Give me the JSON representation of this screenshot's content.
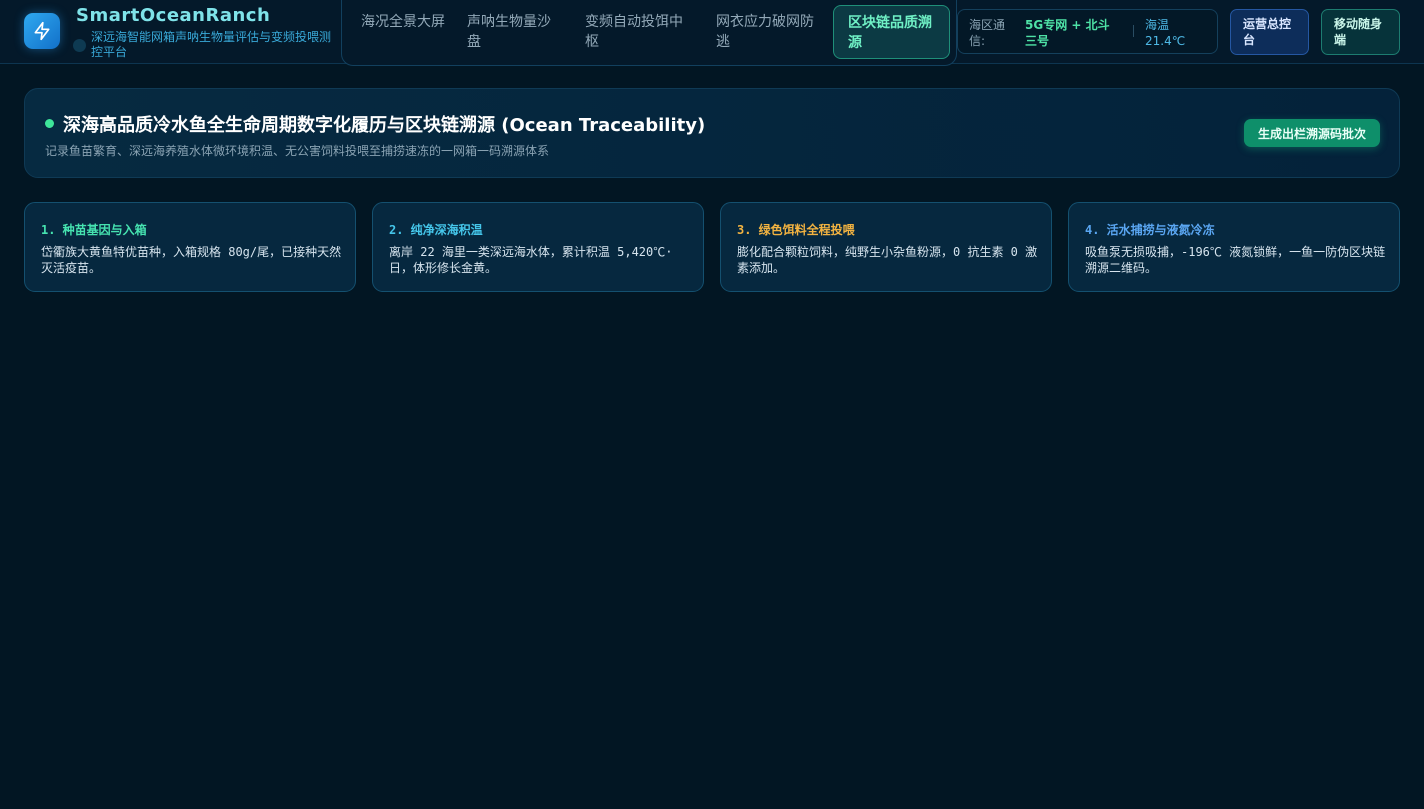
{
  "brand": {
    "title": "SmartOceanRanch",
    "subtitle": "深远海智能网箱声呐生物量评估与变频投喂测控平台",
    "logo_icon": "lightning-icon"
  },
  "nav": {
    "items": [
      {
        "label": "海况全景大屏"
      },
      {
        "label": "声呐生物量沙盘"
      },
      {
        "label": "变频自动投饵中枢"
      },
      {
        "label": "网衣应力破网防逃"
      },
      {
        "label": "区块链品质溯源"
      }
    ],
    "active_index": 4
  },
  "comm": {
    "label": "海区通信:",
    "value": "5G专网 + 北斗三号",
    "temp": "海温 21.4℃"
  },
  "buttons": {
    "ops": "运营总控台",
    "mobile": "移动随身端"
  },
  "banner": {
    "title": "深海高品质冷水鱼全生命周期数字化履历与区块链溯源 (Ocean Traceability)",
    "subtitle": "记录鱼苗繁育、深远海养殖水体微环境积温、无公害饲料投喂至捕捞速冻的一网箱一码溯源体系",
    "action": "生成出栏溯源码批次"
  },
  "cards": [
    {
      "title": "1. 种苗基因与入箱",
      "text": "岱衢族大黄鱼特优苗种，入箱规格 80g/尾，已接种天然灭活疫苗。",
      "color": "#46e3b0"
    },
    {
      "title": "2. 纯净深海积温",
      "text": "离岸 22 海里一类深远海水体，累计积温 5,420℃·日，体形修长金黄。",
      "color": "#45c6ea"
    },
    {
      "title": "3. 绿色饵料全程投喂",
      "text": "膨化配合颗粒饲料，纯野生小杂鱼粉源，0 抗生素 0 激素添加。",
      "color": "#f2b341"
    },
    {
      "title": "4. 活水捕捞与液氮冷冻",
      "text": "吸鱼泵无损吸捕，-196℃ 液氮锁鲜，一鱼一防伪区块链溯源二维码。",
      "color": "#5aa6f2"
    }
  ],
  "colors": {
    "background": "#021623",
    "accent_green": "#0e8f6a",
    "active_tab_text": "#6ff0c5"
  }
}
